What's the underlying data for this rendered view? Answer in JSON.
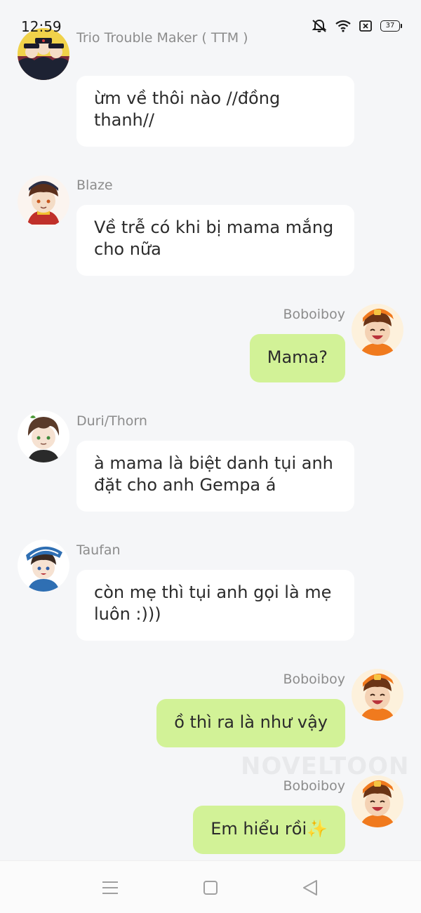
{
  "status_bar": {
    "time": "12:59",
    "battery": "37"
  },
  "messages": [
    {
      "side": "left",
      "sender": "Trio Trouble Maker ( TTM )",
      "text": "ừm về thôi nào //đồng thanh//"
    },
    {
      "side": "left",
      "sender": "Blaze",
      "text": "Về trễ có khi bị mama mắng cho nữa"
    },
    {
      "side": "right",
      "sender": "Boboiboy",
      "text": "Mama?"
    },
    {
      "side": "left",
      "sender": "Duri/Thorn",
      "text": "à mama là biệt danh tụi anh đặt cho anh Gempa á"
    },
    {
      "side": "left",
      "sender": "Taufan",
      "text": "còn mẹ thì tụi anh gọi là mẹ luôn :)))"
    },
    {
      "side": "right",
      "sender": "Boboiboy",
      "text": "ồ thì ra là như vậy"
    },
    {
      "side": "right",
      "sender": "Boboiboy",
      "text": "Em hiểu rồi✨"
    }
  ],
  "watermark": "NOVELTOON",
  "nav": {
    "menu_icon": "menu-icon",
    "home_icon": "home-square-icon",
    "back_icon": "back-triangle-icon"
  },
  "colors": {
    "background": "#f5f6f8",
    "incoming_bubble": "#ffffff",
    "outgoing_bubble": "#d2f297",
    "sender_name": "#8c8c8c"
  }
}
